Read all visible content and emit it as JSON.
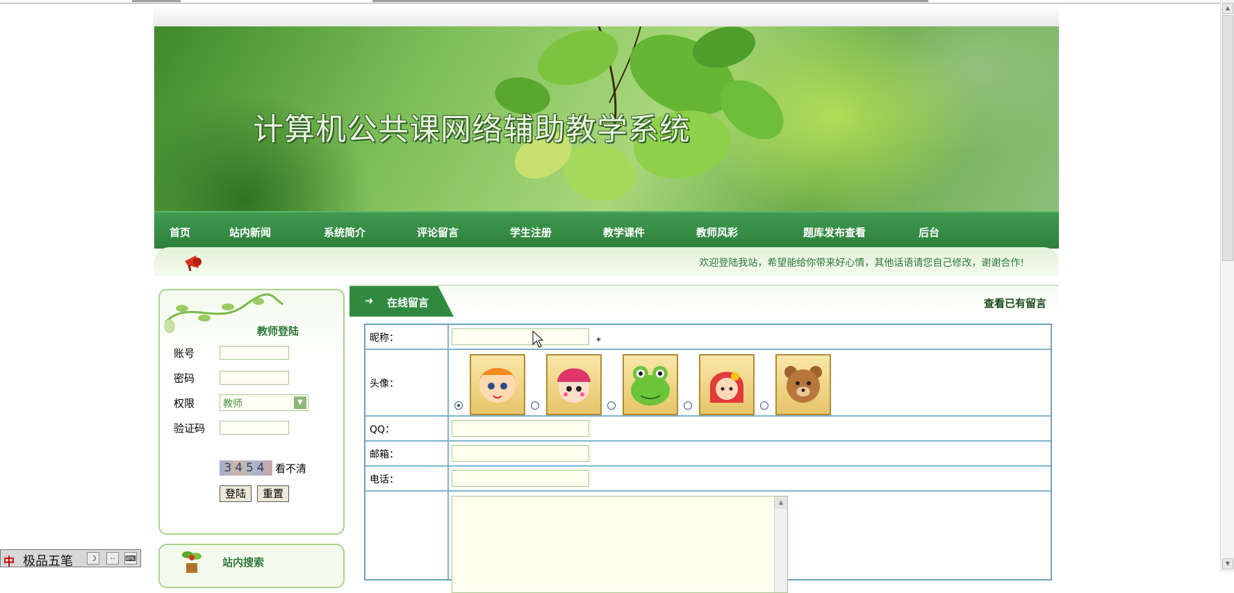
{
  "banner": {
    "title": "计算机公共课网络辅助教学系统"
  },
  "nav": {
    "items": [
      "首页",
      "站内新闻",
      "系统简介",
      "评论留言",
      "学生注册",
      "教学课件",
      "教师风彩",
      "题库发布查看",
      "后台"
    ]
  },
  "notice": {
    "text": "欢迎登陆我站，希望能给你带来好心情，其他话语请您自己修改，谢谢合作!"
  },
  "login": {
    "title": "教师登陆",
    "account_label": "账号",
    "password_label": "密码",
    "role_label": "权限",
    "role_value": "教师",
    "captcha_label": "验证码",
    "captcha_code": "3454",
    "captcha_refresh": "看不清",
    "login_button": "登陆",
    "reset_button": "重置"
  },
  "search_panel": {
    "title": "站内搜索"
  },
  "message": {
    "tab_label": "在线留言",
    "tab_arrow": "➜",
    "view_link": "查看已有留言",
    "fields": {
      "nickname_label": "昵称：",
      "avatar_label": "头像：",
      "qq_label": "QQ：",
      "email_label": "邮箱：",
      "phone_label": "电话："
    },
    "required_mark": "*",
    "avatars": [
      "orange-hair-girl-avatar",
      "pink-helmet-girl-avatar",
      "frog-avatar",
      "red-hood-kid-avatar",
      "teddy-bear-avatar"
    ],
    "selected_avatar": 0
  },
  "ime": {
    "logo": "中",
    "name": "极品五笔"
  },
  "colors": {
    "nav": "#2e7f3c",
    "accent_text": "#2d7a3a",
    "table_border": "#7fb2d0"
  }
}
